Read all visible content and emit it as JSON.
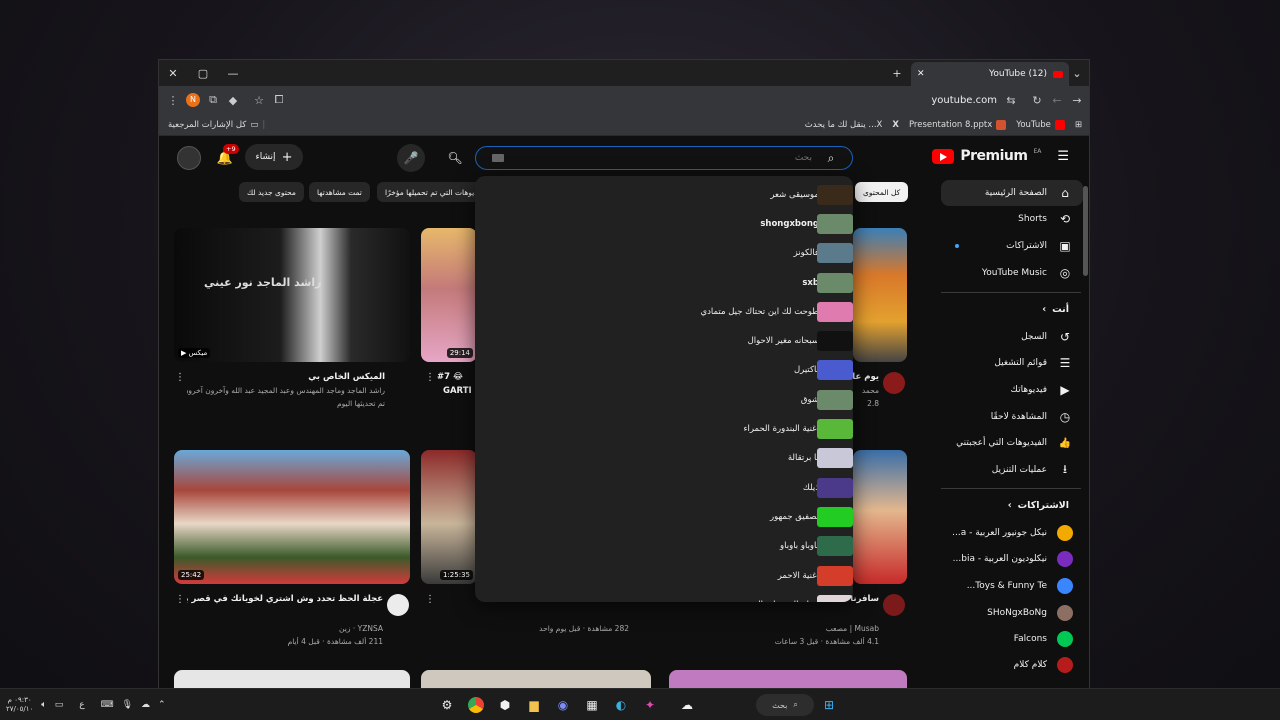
{
  "browser": {
    "tab_title": "(12) YouTube",
    "url": "youtube.com",
    "bookmarks": [
      {
        "label": "YouTube",
        "color": "#ff0000"
      },
      {
        "label": "Presentation 8.pptx",
        "color": "#d35230"
      },
      {
        "label": "X",
        "color": "#ffffff"
      },
      {
        "label": "ينقل لك ما يحدث ...X",
        "color": "#ffffff"
      }
    ],
    "all_bookmarks": "كل الإشارات المرجعية"
  },
  "masthead": {
    "logo_text": "Premium",
    "logo_sup": "EA",
    "search_placeholder": "بحث",
    "create_label": "إنشاء",
    "notif_count": "+9"
  },
  "sidebar": {
    "main": [
      {
        "label": "الصفحة الرئيسية",
        "icon": "home-icon",
        "glyph": "⌂"
      },
      {
        "label": "Shorts",
        "icon": "shorts-icon",
        "glyph": "⟲"
      },
      {
        "label": "الاشتراكات",
        "icon": "subscriptions-icon",
        "glyph": "▣"
      },
      {
        "label": "YouTube Music",
        "icon": "music-icon",
        "glyph": "◎"
      }
    ],
    "you_header": "أنت",
    "you": [
      {
        "label": "السجل",
        "icon": "history-icon",
        "glyph": "↺"
      },
      {
        "label": "قوائم التشغيل",
        "icon": "playlists-icon",
        "glyph": "☰"
      },
      {
        "label": "فيديوهاتك",
        "icon": "your-videos-icon",
        "glyph": "▶"
      },
      {
        "label": "المشاهدة لاحقًا",
        "icon": "watch-later-icon",
        "glyph": "◷"
      },
      {
        "label": "الفيديوهات التي أعجبتني",
        "icon": "like-icon",
        "glyph": "👍"
      },
      {
        "label": "عمليات التنزيل",
        "icon": "download-icon",
        "glyph": "⭳"
      }
    ],
    "subs_header": "الاشتراكات",
    "subs": [
      {
        "label": "نيكل جونيور العربية - a...",
        "color": "#f2a900"
      },
      {
        "label": "نيكلوديون العربية - bia...",
        "color": "#7b2cbf"
      },
      {
        "label": "Toys & Funny Te...",
        "color": "#3a86ff"
      },
      {
        "label": "SHoNgxBoNg",
        "color": "#8d6e63"
      },
      {
        "label": "Falcons",
        "color": "#00c853"
      },
      {
        "label": "كلام كلام",
        "color": "#b71c1c"
      }
    ]
  },
  "chips": [
    "كل المحتوى",
    "الفيديوهات التي تم تحميلها مؤخرًا",
    "تمت مشاهدتها",
    "محتوى جديد لك"
  ],
  "suggestions": [
    {
      "text": "موسيقى شعر",
      "thumb": "#3a2a1a"
    },
    {
      "text": "shongxbong",
      "thumb": "#6a8a6a",
      "bold": true
    },
    {
      "text": "فالكونز",
      "thumb": "#5b7a8c"
    },
    {
      "text": "sxb",
      "thumb": "#6a8a6a",
      "bold": true
    },
    {
      "text": "طوحت لك اين تحتاك جيل متمادي",
      "thumb": "#e07bb0"
    },
    {
      "text": "سبحانه مغير الاحوال",
      "thumb": "#111111"
    },
    {
      "text": "باكتيرل",
      "thumb": "#4a5bd0"
    },
    {
      "text": "شوق",
      "thumb": "#6a8a6a"
    },
    {
      "text": "اغنية البندورة الحمراء",
      "thumb": "#59b83a"
    },
    {
      "text": "يا برتقالة",
      "thumb": "#c8c8d8"
    },
    {
      "text": "ذيلك",
      "thumb": "#4b3a8a"
    },
    {
      "text": "تصفيق جمهور",
      "thumb": "#22cc22"
    },
    {
      "text": "باوباو باوباو",
      "thumb": "#2e6b4a"
    },
    {
      "text": "اغنية الاحمر",
      "thumb": "#d43d2a"
    },
    {
      "text": "صباح الخير يا مثال",
      "thumb": "#e0d5d8"
    }
  ],
  "videos": [
    {
      "title": "الميكس الخاص بي",
      "meta1": "راشد الماجد وماجد المهندس وعبد المجيد عبد الله وآخرون آخرون",
      "meta2": "تم تحديثها اليوم",
      "badge": "ميكس",
      "thumb_text": "راشد الماجد نور عيني"
    },
    {
      "title": "#7 😂",
      "title2": "GARTI",
      "duration": "29:14"
    },
    {
      "title": "يوم عا",
      "meta1": "محمد",
      "meta2": "2.8"
    },
    {
      "title": "عجلة الحظ تحدد وش اشتري لخوياتك في قصر باور",
      "channel": "YZNSA · زين",
      "views": "211 ألف مشاهدة · قبل 4 أيام",
      "duration": "25:42"
    },
    {
      "title": "",
      "views": "282 مشاهدة · قبل يوم واحد",
      "duration": "1:25:35"
    },
    {
      "title": "سافرنا الثاني",
      "channel": "Musab | مصعب",
      "views": "4.1 ألف مشاهدة · قبل 3 ساعات"
    }
  ],
  "taskbar": {
    "search_label": "بحث",
    "time": "٠٩:٣٠ م",
    "date": "٢٧/٠٥/١٠"
  },
  "colors": {
    "brand_red": "#ff0000",
    "search_focus": "#1c62b9",
    "page_bg": "#0f0f0f"
  }
}
